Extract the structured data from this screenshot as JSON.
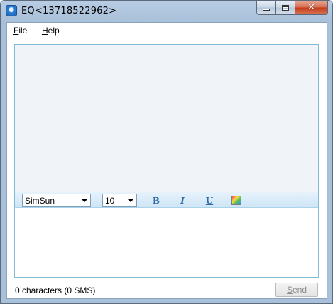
{
  "window": {
    "title": "EQ<13718522962>",
    "icons": {
      "app": "app-logo-icon",
      "minimize": "minimize-icon",
      "maximize": "maximize-icon",
      "close": "close-icon"
    },
    "close_glyph": "✕"
  },
  "menu": {
    "items": [
      {
        "id": "file",
        "mnemonic": "F",
        "rest": "ile"
      },
      {
        "id": "help",
        "mnemonic": "H",
        "rest": "elp"
      }
    ]
  },
  "toolbar": {
    "font": {
      "value": "SimSun"
    },
    "size": {
      "value": "10"
    },
    "bold_label": "B",
    "italic_label": "I",
    "underline_label": "U",
    "color_icon": "text-color-icon"
  },
  "composer": {
    "value": ""
  },
  "status": {
    "count_text": "0 characters (0 SMS)",
    "send_mnemonic": "S",
    "send_rest": "end"
  },
  "colors": {
    "accent_border": "#7fbcd6",
    "toolbar_blue": "#cfe5f6",
    "history_bg": "#f0f4f8",
    "close_red": "#c2391c"
  }
}
